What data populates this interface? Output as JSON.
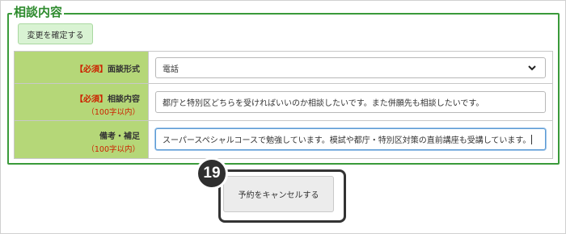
{
  "section": {
    "legend": "相談内容",
    "confirm_button": "変更を確定する"
  },
  "form": {
    "rows": [
      {
        "required_tag": "【必須】",
        "label": "面談形式",
        "sublabel": "",
        "control": "select",
        "value": "電話"
      },
      {
        "required_tag": "【必須】",
        "label": "相談内容",
        "sublabel": "（100字以内）",
        "control": "text",
        "value": "都庁と特別区どちらを受ければいいのか相談したいです。また併願先も相談したいです。"
      },
      {
        "required_tag": "",
        "label": "備考・補足",
        "sublabel": "（100字以内）",
        "control": "text",
        "value": "スーパースペシャルコースで勉強しています。模試や都庁・特別区対策の直前講座も受講しています。"
      }
    ]
  },
  "cancel_button": "予約をキャンセルする",
  "step_badge": "19",
  "colors": {
    "accent_green": "#3a9a3a",
    "label_bg": "#b5d778",
    "required_red": "#cc2200",
    "confirm_bg": "#d9f3d3",
    "badge_bg": "#2f2f2f"
  },
  "icons": {
    "select_arrow": "chevron-down-icon"
  }
}
